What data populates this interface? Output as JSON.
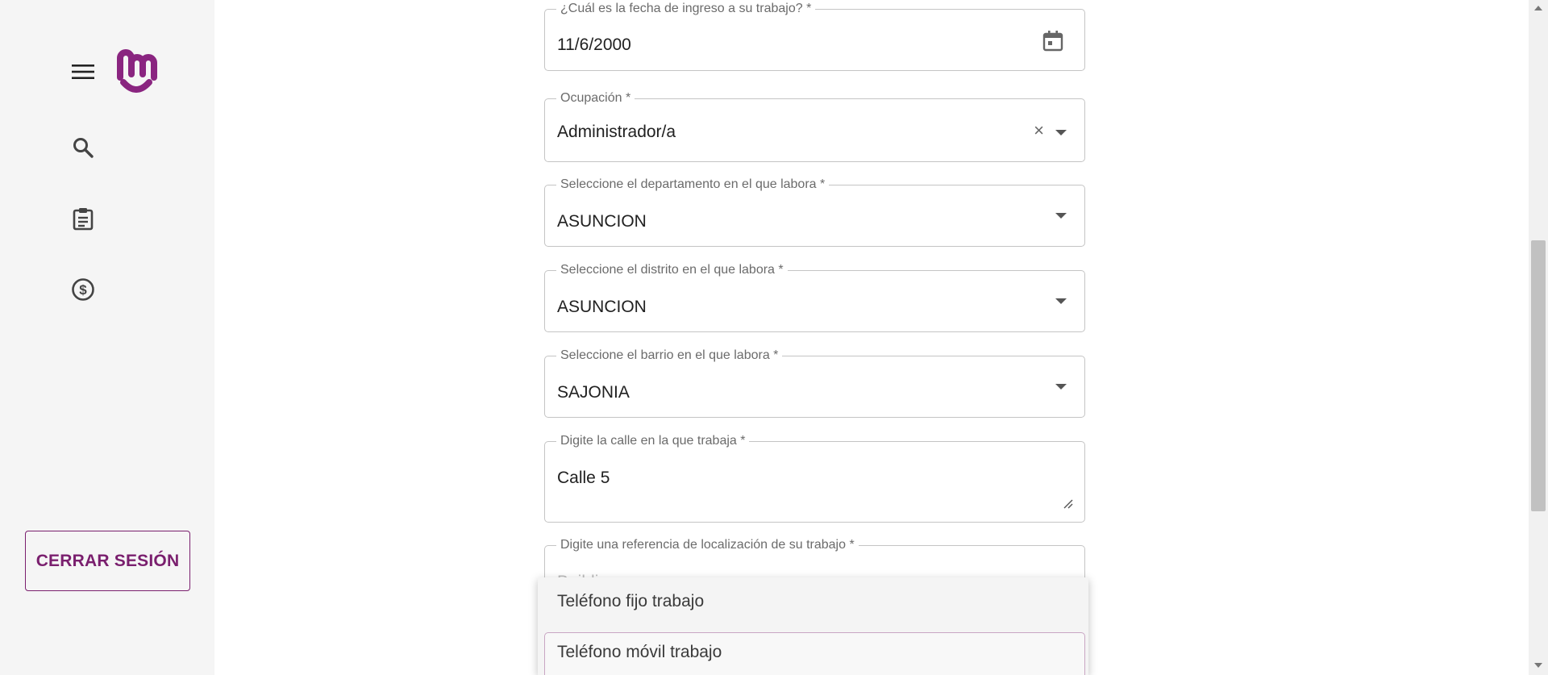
{
  "sidebar": {
    "logout_label": "CERRAR SESIÓN"
  },
  "colors": {
    "brand": "#8a2580",
    "logout_border": "#7a1f6e"
  },
  "form": {
    "fecha_ingreso": {
      "label": "¿Cuál es la fecha de ingreso a su trabajo? *",
      "value": "11/6/2000"
    },
    "ocupacion": {
      "label": "Ocupación *",
      "value": "Administrador/a"
    },
    "departamento": {
      "label": "Seleccione el departamento en el que labora *",
      "value": "ASUNCION"
    },
    "distrito": {
      "label": "Seleccione el distrito en el que labora *",
      "value": "ASUNCION"
    },
    "barrio": {
      "label": "Seleccione el barrio en el que labora *",
      "value": "SAJONIA"
    },
    "calle": {
      "label": "Digite la calle en la que trabaja *",
      "value": "Calle 5"
    },
    "referencia": {
      "label": "Digite una referencia de localización de su trabajo *",
      "value": "Building"
    }
  },
  "dropdown": {
    "options": [
      "Teléfono fijo trabajo",
      "Teléfono móvil trabajo"
    ]
  },
  "icons": {
    "menu": "hamburger-menu-icon",
    "search": "search-icon",
    "clipboard": "clipboard-icon",
    "money": "dollar-circle-icon",
    "calendar": "calendar-icon"
  }
}
